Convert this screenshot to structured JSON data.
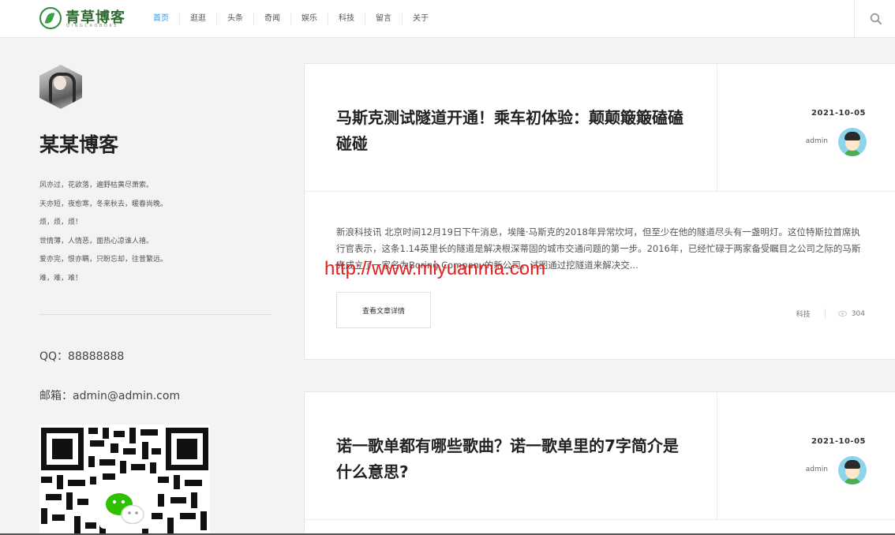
{
  "header": {
    "logo": {
      "name": "青草博客",
      "subtitle": "QINGCAOBOKE"
    },
    "nav": [
      "首页",
      "逛逛",
      "头条",
      "奇闻",
      "娱乐",
      "科技",
      "留言",
      "关于"
    ],
    "active_nav": "首页",
    "search_icon": "search-icon"
  },
  "sidebar": {
    "blog_name": "某某博客",
    "bio": [
      "风亦过，花欲落，遍野枯黄尽萧索。",
      "天亦短，夜愈寒，冬来秋去，暖春尚晚。",
      "烦，烦，烦！",
      "世情薄，人情恶，面热心凉谁人禧。",
      "爱亦完，恨亦瞒，只盼忘却，往昔繁远。",
      "难，难，难！"
    ],
    "qq": "QQ：88888888",
    "email": "邮箱：admin@admin.com"
  },
  "posts": [
    {
      "title": "马斯克测试隧道开通！乘车初体验：颠颠簸簸磕磕碰碰",
      "date": "2021-10-05",
      "author": "admin",
      "excerpt": "新浪科技讯 北京时间12月19日下午消息，埃隆·马斯克的2018年异常坎坷，但至少在他的隧道尽头有一盏明灯。这位特斯拉首席执行官表示，这条1.14英里长的隧道是解决根深蒂固的城市交通问题的第一步。2016年，已经忙碌于两家备受瞩目之公司之际的马斯克成立了一家名为Boring Company的新公司，试图通过挖隧道来解决交...",
      "button": "查看文章详情",
      "category": "科技",
      "views": "304"
    },
    {
      "title": "诺一歌单都有哪些歌曲？诺一歌单里的7字简介是什么意思?",
      "date": "2021-10-05",
      "author": "admin"
    }
  ],
  "watermark": "http://www.miyuanma.com",
  "colors": {
    "accent": "#3a9ad9",
    "brand": "#2d6b2f",
    "watermark": "#e42020"
  }
}
